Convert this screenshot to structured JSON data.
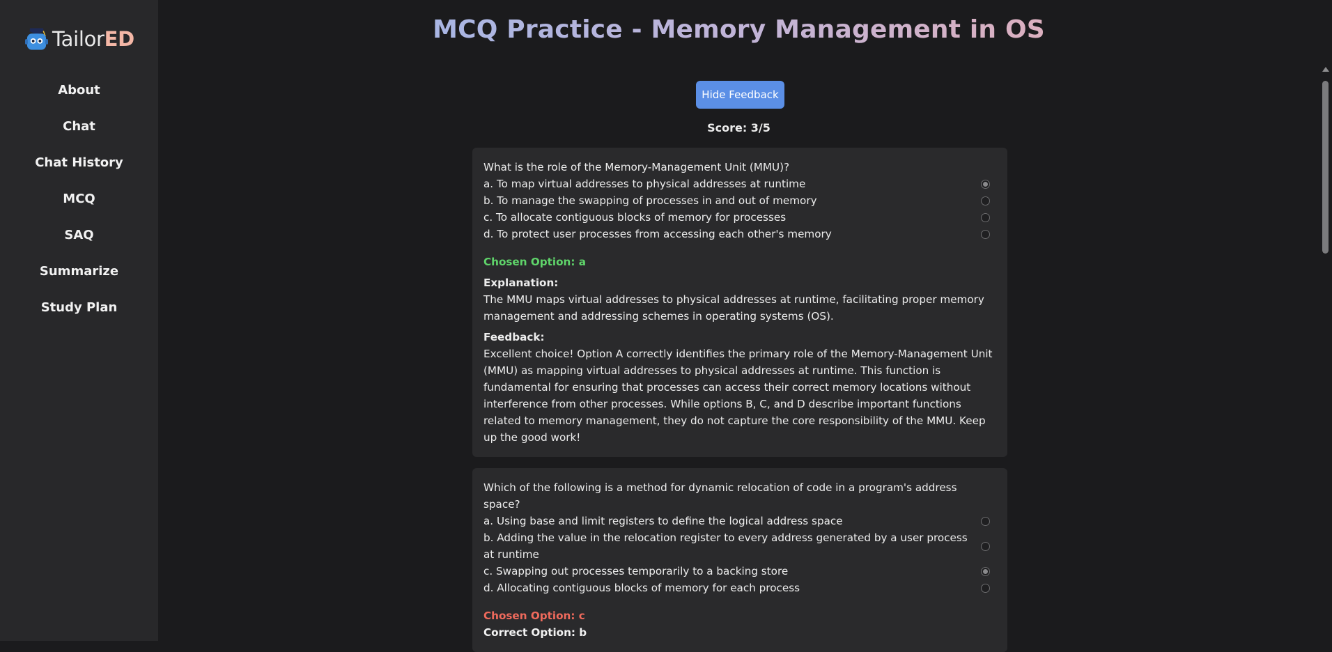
{
  "app": {
    "logo_main": "Tailor",
    "logo_accent": "ED"
  },
  "sidebar": {
    "items": [
      {
        "label": "About"
      },
      {
        "label": "Chat"
      },
      {
        "label": "Chat History"
      },
      {
        "label": "MCQ"
      },
      {
        "label": "SAQ"
      },
      {
        "label": "Summarize"
      },
      {
        "label": "Study Plan"
      }
    ]
  },
  "main": {
    "title": "MCQ Practice - Memory Management in OS",
    "hide_feedback_label": "Hide Feedback",
    "score": "Score: 3/5",
    "questions": [
      {
        "question": "What is the role of the Memory-Management Unit (MMU)?",
        "options": [
          {
            "text": "a. To map virtual addresses to physical addresses at runtime",
            "selected": true
          },
          {
            "text": "b. To manage the swapping of processes in and out of memory",
            "selected": false
          },
          {
            "text": "c. To allocate contiguous blocks of memory for processes",
            "selected": false
          },
          {
            "text": "d. To protect user processes from accessing each other's memory",
            "selected": false
          }
        ],
        "chosen": "Chosen Option: a",
        "explanation_label": "Explanation:",
        "explanation": "The MMU maps virtual addresses to physical addresses at runtime, facilitating proper memory management and addressing schemes in operating systems (OS).",
        "feedback_label": "Feedback:",
        "feedback": "Excellent choice! Option A correctly identifies the primary role of the Memory-Management Unit (MMU) as mapping virtual addresses to physical addresses at runtime. This function is fundamental for ensuring that processes can access their correct memory locations without interference from other processes. While options B, C, and D describe important functions related to memory management, they do not capture the core responsibility of the MMU. Keep up the good work!"
      },
      {
        "question": "Which of the following is a method for dynamic relocation of code in a program's address space?",
        "options": [
          {
            "text": "a. Using base and limit registers to define the logical address space",
            "selected": false
          },
          {
            "text": "b. Adding the value in the relocation register to every address generated by a user process at runtime",
            "selected": false
          },
          {
            "text": "c. Swapping out processes temporarily to a backing store",
            "selected": true
          },
          {
            "text": "d. Allocating contiguous blocks of memory for each process",
            "selected": false
          }
        ],
        "chosen": "Chosen Option: c",
        "correct": "Correct Option: b"
      }
    ]
  },
  "colors": {
    "sidebar_bg": "#28282a",
    "page_bg": "#1b1b1d",
    "card_bg": "#2a2a2c",
    "button_blue": "#5b8fe6",
    "chosen_correct": "#5fd46a",
    "chosen_wrong": "#ef6a5c",
    "logo_accent": "#f4b7a6"
  },
  "icons": {
    "logo": "robot-mascot-icon"
  }
}
